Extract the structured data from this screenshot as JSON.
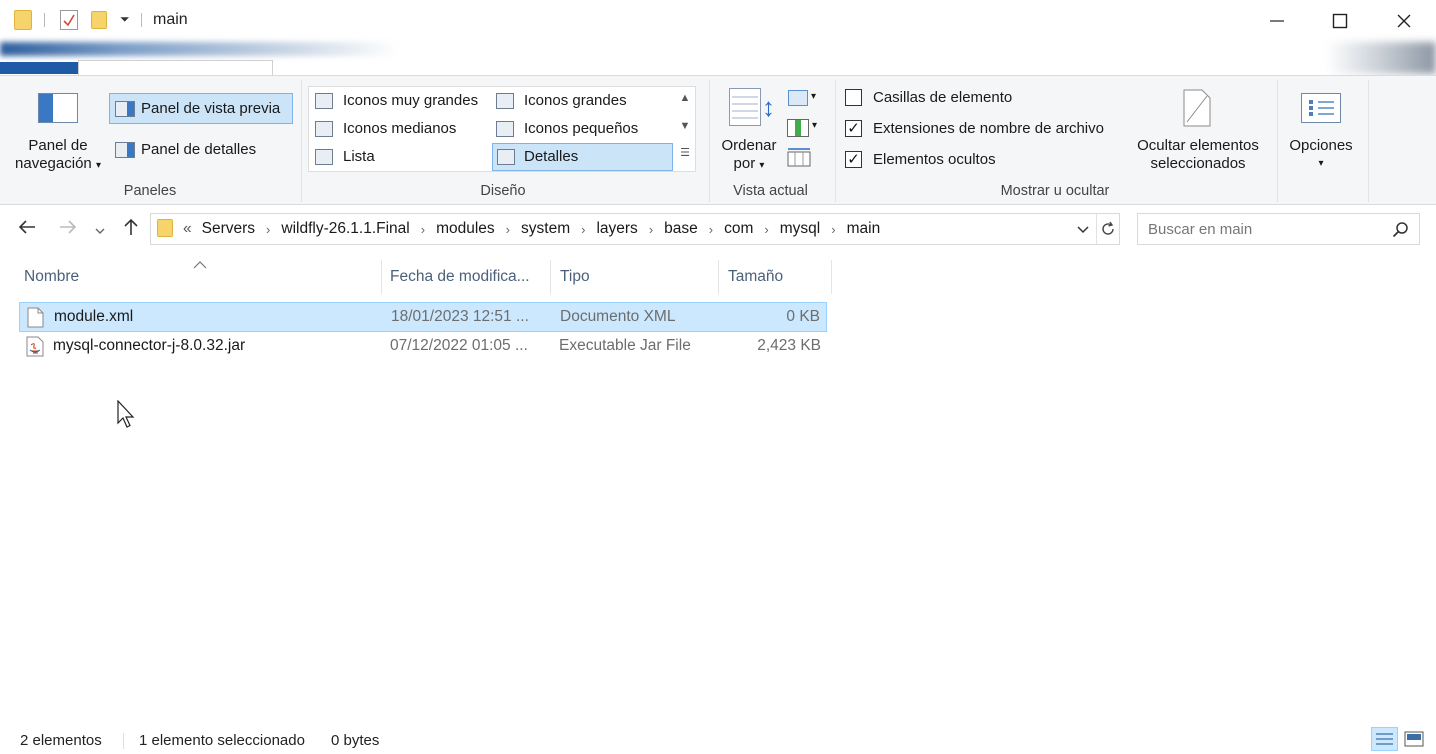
{
  "window": {
    "title": "main"
  },
  "ribbon": {
    "panes": {
      "nav_pane_label_line1": "Panel de",
      "nav_pane_label_line2": "navegación",
      "preview_pane": "Panel de vista previa",
      "details_pane": "Panel de detalles",
      "group_label": "Paneles"
    },
    "layout": {
      "items": [
        "Iconos muy grandes",
        "Iconos grandes",
        "Iconos medianos",
        "Iconos pequeños",
        "Lista",
        "Detalles"
      ],
      "selected": "Detalles",
      "group_label": "Diseño"
    },
    "current_view": {
      "sort_line1": "Ordenar",
      "sort_line2": "por",
      "group_label": "Vista actual"
    },
    "show_hide": {
      "item_checkboxes": {
        "label": "Casillas de elemento",
        "checked": false
      },
      "file_extensions": {
        "label": "Extensiones de nombre de archivo",
        "checked": true
      },
      "hidden_items": {
        "label": "Elementos ocultos",
        "checked": true
      },
      "hide_selected_line1": "Ocultar elementos",
      "hide_selected_line2": "seleccionados",
      "group_label": "Mostrar u ocultar"
    },
    "options": {
      "label": "Opciones"
    }
  },
  "address": {
    "overflow": "«",
    "breadcrumbs": [
      "Servers",
      "wildfly-26.1.1.Final",
      "modules",
      "system",
      "layers",
      "base",
      "com",
      "mysql",
      "main"
    ]
  },
  "search": {
    "placeholder": "Buscar en main"
  },
  "columns": {
    "name": "Nombre",
    "date": "Fecha de modifica...",
    "type": "Tipo",
    "size": "Tamaño"
  },
  "files": [
    {
      "name": "module.xml",
      "date": "18/01/2023 12:51 ...",
      "type": "Documento XML",
      "size": "0 KB",
      "icon": "xml-file-icon",
      "selected": true
    },
    {
      "name": "mysql-connector-j-8.0.32.jar",
      "date": "07/12/2022 01:05 ...",
      "type": "Executable Jar File",
      "size": "2,423 KB",
      "icon": "jar-file-icon",
      "selected": false
    }
  ],
  "status": {
    "count": "2 elementos",
    "selection": "1 elemento seleccionado",
    "bytes": "0 bytes"
  },
  "colors": {
    "selection_bg": "#cce8ff",
    "selection_border": "#99d1ff",
    "ribbon_bg": "#f5f6f7",
    "folder_yellow": "#f7d36b"
  }
}
